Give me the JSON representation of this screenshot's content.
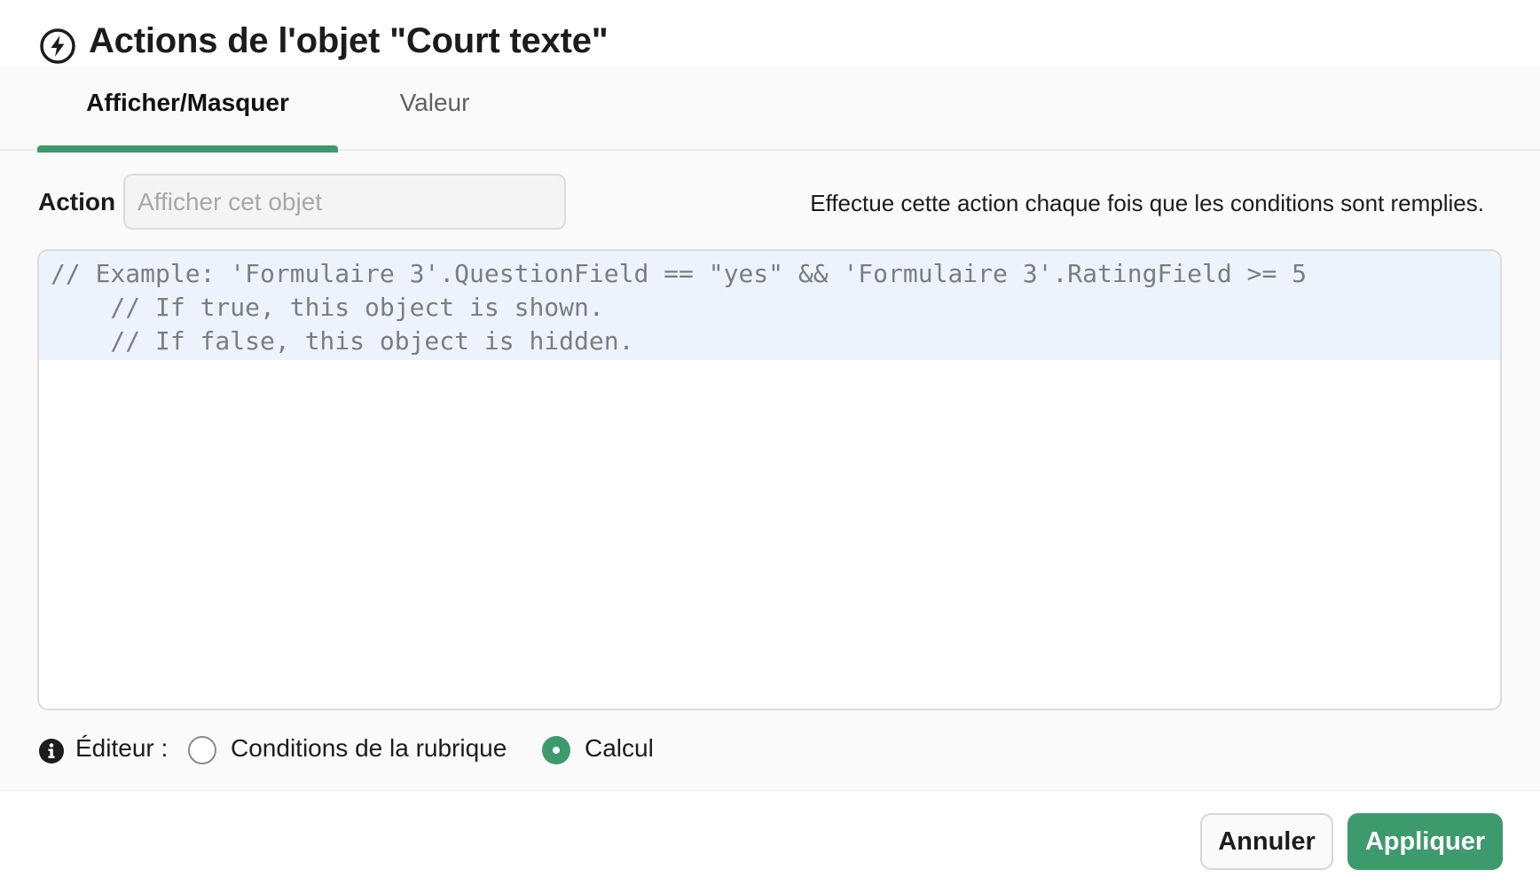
{
  "header": {
    "title": "Actions de l'objet \"Court texte\"",
    "icon": "lightning-bolt-icon"
  },
  "tabs": [
    {
      "label": "Afficher/Masquer",
      "active": true
    },
    {
      "label": "Valeur",
      "active": false
    }
  ],
  "action": {
    "label": "Action",
    "placeholder": "Afficher cet objet",
    "value": "",
    "help": "Effectue cette action chaque fois que les conditions sont remplies."
  },
  "editor": {
    "code": "// Example: 'Formulaire 3'.QuestionField == \"yes\" && 'Formulaire 3'.RatingField >= 5\n    // If true, this object is shown.\n    // If false, this object is hidden."
  },
  "mode": {
    "icon": "info-icon",
    "label": "Éditeur :",
    "options": [
      {
        "label": "Conditions de la rubrique",
        "selected": false
      },
      {
        "label": "Calcul",
        "selected": true
      }
    ]
  },
  "footer": {
    "cancel_label": "Annuler",
    "apply_label": "Appliquer"
  },
  "colors": {
    "accent": "#3d9a6c",
    "highlight": "#edf3fd"
  }
}
